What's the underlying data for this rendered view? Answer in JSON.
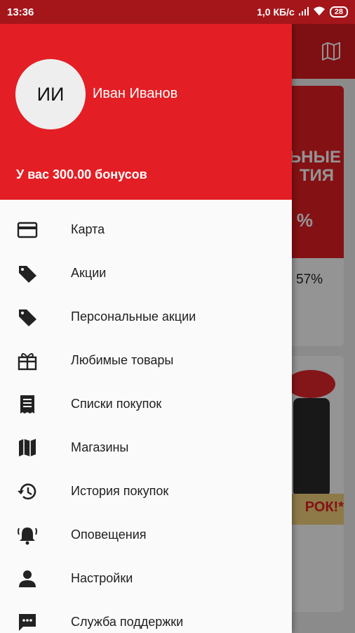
{
  "status_bar": {
    "time": "13:36",
    "network_speed": "1,0 КБ/с",
    "battery": "28"
  },
  "background": {
    "discount_percent": "57%",
    "promo_text_line1": "ЬНЫЕ",
    "promo_text_line2": "ТИЯ",
    "promo_percent_partial": "%",
    "gift_text": "РОК!*"
  },
  "drawer": {
    "avatar_initials": "ИИ",
    "user_name": "Иван Иванов",
    "bonus_text": "У вас 300.00 бонусов",
    "menu": [
      {
        "label": "Карта",
        "icon": "card-icon"
      },
      {
        "label": "Акции",
        "icon": "tag-icon"
      },
      {
        "label": "Персональные акции",
        "icon": "tag-icon"
      },
      {
        "label": "Любимые товары",
        "icon": "gift-icon"
      },
      {
        "label": "Списки покупок",
        "icon": "receipt-list-icon"
      },
      {
        "label": "Магазины",
        "icon": "map-icon"
      },
      {
        "label": "История покупок",
        "icon": "history-icon"
      },
      {
        "label": "Оповещения",
        "icon": "bell-icon"
      },
      {
        "label": "Настройки",
        "icon": "person-icon"
      },
      {
        "label": "Служба поддержки",
        "icon": "chat-icon"
      }
    ]
  },
  "colors": {
    "primary": "#e31e24",
    "status_bar": "#a5161b"
  }
}
